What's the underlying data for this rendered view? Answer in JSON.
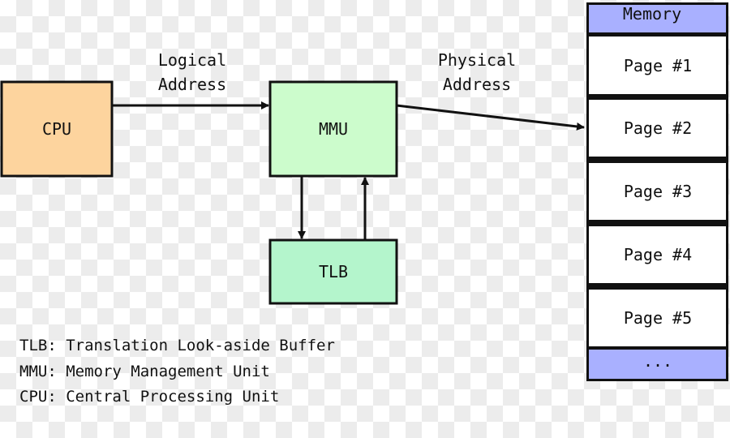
{
  "nodes": {
    "cpu": "CPU",
    "mmu": "MMU",
    "tlb": "TLB"
  },
  "edges": {
    "logical": [
      "Logical",
      "Address"
    ],
    "physical": [
      "Physical",
      "Address"
    ]
  },
  "memory": {
    "header": "Memory",
    "pages": [
      "Page #1",
      "Page #2",
      "Page #3",
      "Page #4",
      "Page #5"
    ],
    "footer": "..."
  },
  "legend": [
    "TLB: Translation Look-aside Buffer",
    "MMU: Memory Management Unit",
    "CPU: Central Processing Unit"
  ],
  "colors": {
    "cpu": "#fdd49e",
    "mmu": "#ccfccc",
    "tlb": "#b4f5cc",
    "memory_header": "#a9b0ff"
  }
}
